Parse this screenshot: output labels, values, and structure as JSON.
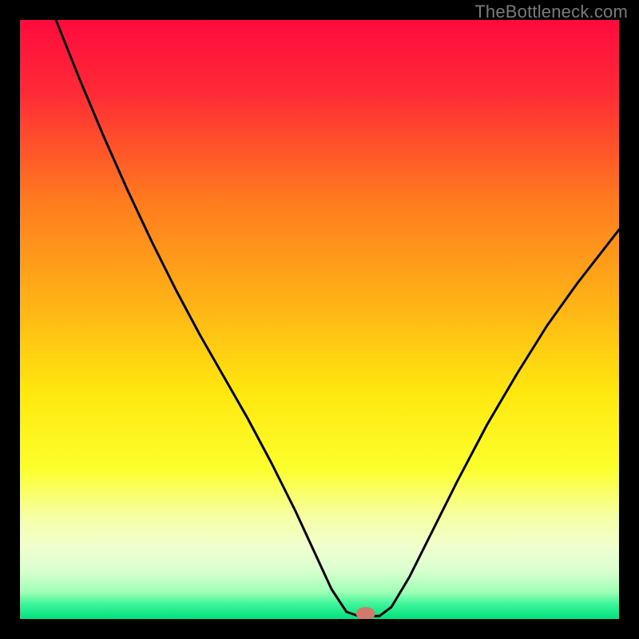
{
  "watermark": "TheBottleneck.com",
  "chart_data": {
    "type": "line",
    "title": "",
    "xlabel": "",
    "ylabel": "",
    "xlim": [
      0,
      100
    ],
    "ylim": [
      0,
      100
    ],
    "grid": false,
    "legend": false,
    "gradient_stops": [
      {
        "pos": 0.0,
        "color": "#ff0b3d"
      },
      {
        "pos": 0.12,
        "color": "#ff2a36"
      },
      {
        "pos": 0.3,
        "color": "#ff7a1f"
      },
      {
        "pos": 0.48,
        "color": "#ffb516"
      },
      {
        "pos": 0.62,
        "color": "#ffe70e"
      },
      {
        "pos": 0.75,
        "color": "#fcff2d"
      },
      {
        "pos": 0.83,
        "color": "#f6ffa5"
      },
      {
        "pos": 0.88,
        "color": "#f0ffcf"
      },
      {
        "pos": 0.92,
        "color": "#d9ffd0"
      },
      {
        "pos": 0.955,
        "color": "#9fffb5"
      },
      {
        "pos": 0.975,
        "color": "#3df59a"
      },
      {
        "pos": 1.0,
        "color": "#00e07e"
      }
    ],
    "series": [
      {
        "name": "curve",
        "stroke": "#000000",
        "stroke_width": 3,
        "x": [
          6.0,
          10.0,
          14.0,
          18.0,
          22.0,
          26.0,
          30.0,
          34.0,
          38.0,
          42.0,
          46.0,
          49.0,
          52.0,
          54.5,
          56.5,
          60.0,
          62.0,
          65.0,
          69.0,
          73.0,
          78.0,
          83.0,
          88.0,
          93.0,
          100.0
        ],
        "y": [
          100.0,
          90.0,
          80.5,
          71.5,
          63.0,
          55.0,
          47.5,
          40.5,
          33.5,
          26.0,
          18.0,
          11.5,
          5.0,
          1.2,
          0.5,
          0.5,
          2.0,
          7.0,
          15.0,
          23.0,
          32.5,
          41.0,
          49.0,
          56.0,
          65.0
        ]
      }
    ],
    "marker": {
      "x": 57.7,
      "y": 0.9,
      "rx": 1.6,
      "ry": 1.1,
      "fill": "#cf7a6b"
    }
  }
}
